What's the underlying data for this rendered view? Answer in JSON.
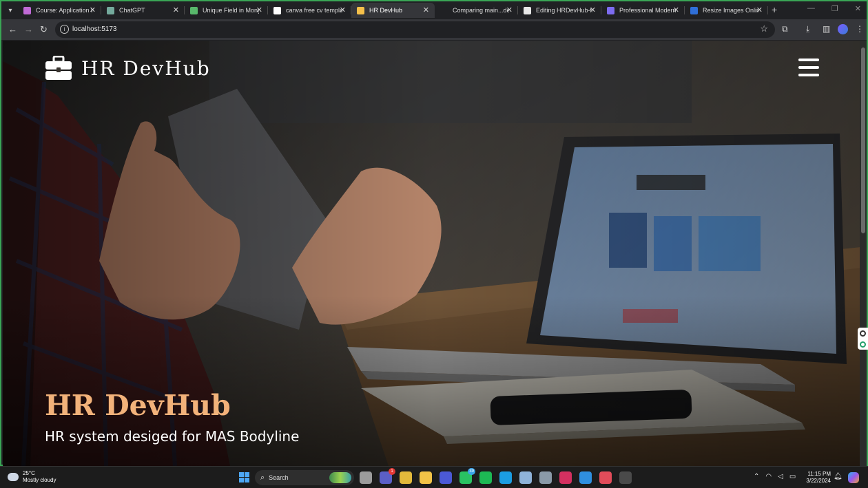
{
  "browser": {
    "tabs": [
      {
        "title": "Course: Application F",
        "color": "#c06ad6",
        "active": false
      },
      {
        "title": "ChatGPT",
        "color": "#74aa9c",
        "active": false
      },
      {
        "title": "Unique Field in Mong",
        "color": "#58b86b",
        "active": false
      },
      {
        "title": "canva free cv templat",
        "color": "#ffffff",
        "active": false
      },
      {
        "title": "HR DevHub",
        "color": "#f5c04a",
        "active": true
      },
      {
        "title": "Comparing main...de",
        "color": "#202124",
        "active": false
      },
      {
        "title": "Editing HRDevHub-fr",
        "color": "#e8e8e8",
        "active": false
      },
      {
        "title": "Professional Modern",
        "color": "#7d6cf0",
        "active": false
      },
      {
        "title": "Resize Images Online",
        "color": "#2f6fd8",
        "active": false
      }
    ],
    "url": "localhost:5173"
  },
  "page": {
    "brand_name": "HR DevHub",
    "hero_title": "HR DevHub",
    "hero_subtitle": "HR system desiged for MAS Bodyline",
    "accent_color": "#f2b27a"
  },
  "taskbar": {
    "weather_temp": "25°C",
    "weather_desc": "Mostly cloudy",
    "search_label": "Search",
    "time": "11:15 PM",
    "date": "3/22/2024",
    "apps": [
      {
        "name": "task-view",
        "color": "#9c9c9c",
        "badge": ""
      },
      {
        "name": "teams",
        "color": "#5b5fc7",
        "badge": "1"
      },
      {
        "name": "chrome",
        "color": "#e2b93b",
        "badge": ""
      },
      {
        "name": "file-explorer",
        "color": "#f2c347",
        "badge": ""
      },
      {
        "name": "visual-studio",
        "color": "#4b59d6",
        "badge": ""
      },
      {
        "name": "whatsapp",
        "color": "#29c262",
        "badge": "39"
      },
      {
        "name": "spotify",
        "color": "#1db954",
        "badge": ""
      },
      {
        "name": "edge",
        "color": "#1b9de2",
        "badge": ""
      },
      {
        "name": "photos",
        "color": "#8fb3d9",
        "badge": ""
      },
      {
        "name": "settings",
        "color": "#8a9aa8",
        "badge": ""
      },
      {
        "name": "intellij",
        "color": "#d43060",
        "badge": ""
      },
      {
        "name": "vscode",
        "color": "#2f8fe0",
        "badge": ""
      },
      {
        "name": "snipping-tool",
        "color": "#e24c5a",
        "badge": ""
      },
      {
        "name": "terminal",
        "color": "#4a4a4a",
        "badge": ""
      }
    ]
  }
}
